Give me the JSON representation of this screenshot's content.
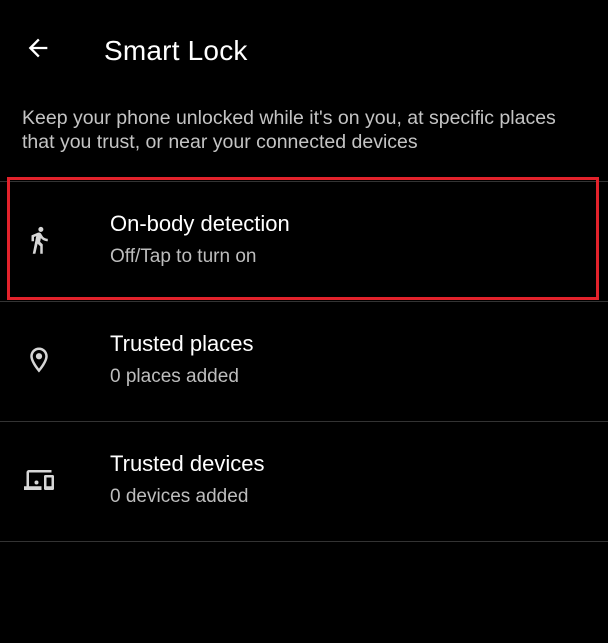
{
  "header": {
    "title": "Smart Lock",
    "back_icon": "arrow-back-icon"
  },
  "description": "Keep your phone unlocked while it's on you, at specific places that you trust, or near your connected devices",
  "items": [
    {
      "title": "On-body detection",
      "subtitle": "Off/Tap to turn on",
      "icon": "walking-person-icon",
      "highlighted": true
    },
    {
      "title": "Trusted places",
      "subtitle": "0 places added",
      "icon": "location-pin-icon"
    },
    {
      "title": "Trusted devices",
      "subtitle": "0 devices added",
      "icon": "devices-icon"
    }
  ],
  "colors": {
    "background": "#000000",
    "text_primary": "#ffffff",
    "text_secondary": "#bdbdbd",
    "highlight": "#e3222b",
    "divider": "#333333"
  }
}
